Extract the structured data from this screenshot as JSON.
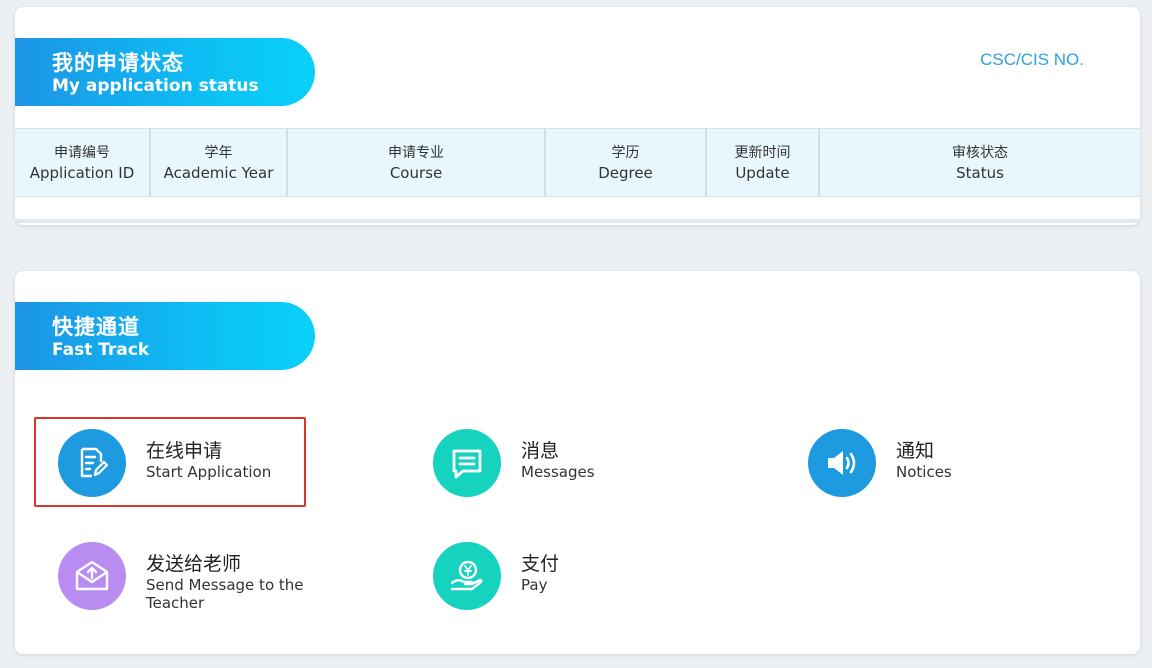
{
  "status_card": {
    "title_zh": "我的申请状态",
    "title_en": "My application status",
    "csc_label": "CSC/CIS NO.",
    "columns": [
      {
        "zh": "申请编号",
        "en": "Application ID"
      },
      {
        "zh": "学年",
        "en": "Academic Year"
      },
      {
        "zh": "申请专业",
        "en": "Course"
      },
      {
        "zh": "学历",
        "en": "Degree"
      },
      {
        "zh": "更新时间",
        "en": "Update"
      },
      {
        "zh": "审核状态",
        "en": "Status"
      }
    ]
  },
  "fast_track": {
    "title_zh": "快捷通道",
    "title_en": "Fast Track",
    "items": [
      {
        "zh": "在线申请",
        "en": "Start Application",
        "icon": "edit-document-icon",
        "color": "#1e9ae0"
      },
      {
        "zh": "消息",
        "en": "Messages",
        "icon": "message-icon",
        "color": "#15d3be"
      },
      {
        "zh": "通知",
        "en": "Notices",
        "icon": "speaker-icon",
        "color": "#1e9ae0"
      },
      {
        "zh": "发送给老师",
        "en": "Send Message to the Teacher",
        "icon": "envelope-icon",
        "color": "#b98cf2"
      },
      {
        "zh": "支付",
        "en": "Pay",
        "icon": "payment-icon",
        "color": "#15d3be"
      }
    ]
  },
  "colors": {
    "accent_blue": "#1d94e6",
    "highlight_red": "#e0322b"
  }
}
